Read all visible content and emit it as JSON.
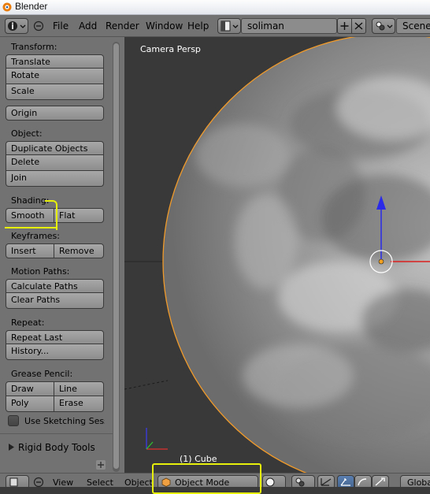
{
  "window": {
    "title": "Blender"
  },
  "menubar": {
    "menus": [
      "File",
      "Add",
      "Render",
      "Window",
      "Help"
    ],
    "screen_name": "soliman",
    "scene_label": "Scene"
  },
  "toolshelf": {
    "transform": {
      "heading": "Transform:",
      "buttons": [
        "Translate",
        "Rotate",
        "Scale"
      ]
    },
    "origin": "Origin",
    "object": {
      "heading": "Object:",
      "buttons": [
        "Duplicate Objects",
        "Delete",
        "Join"
      ]
    },
    "shading": {
      "heading": "Shading:",
      "smooth": "Smooth",
      "flat": "Flat"
    },
    "keyframes": {
      "heading": "Keyframes:",
      "insert": "Insert",
      "remove": "Remove"
    },
    "motion_paths": {
      "heading": "Motion Paths:",
      "buttons": [
        "Calculate Paths",
        "Clear Paths"
      ]
    },
    "repeat": {
      "heading": "Repeat:",
      "buttons": [
        "Repeat Last",
        "History..."
      ]
    },
    "grease_pencil": {
      "heading": "Grease Pencil:",
      "draw": "Draw",
      "line": "Line",
      "poly": "Poly",
      "erase": "Erase",
      "sketching": "Use Sketching Sessi"
    },
    "rigid_body": "Rigid Body Tools"
  },
  "viewport": {
    "view_label": "Camera Persp",
    "object_label": "(1) Cube"
  },
  "bottombar": {
    "menus": [
      "View",
      "Select",
      "Object"
    ],
    "mode": "Object Mode",
    "orientation": "Globa"
  },
  "colors": {
    "highlight": "#e6f00a",
    "selection": "#e38b1e",
    "panel": "#727272"
  }
}
